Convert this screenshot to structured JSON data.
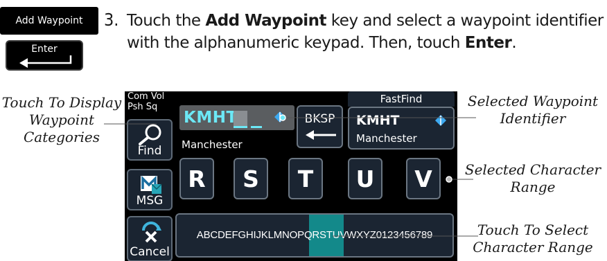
{
  "instruction": {
    "add_waypoint_key": "Add Waypoint",
    "enter_key": "Enter",
    "step_number": "3.",
    "text_1": "Touch the ",
    "bold_1": "Add Waypoint",
    "text_2": " key and select a waypoint identifier with the alphanumeric keypad. Then, touch ",
    "bold_2": "Enter",
    "text_3": "."
  },
  "screen": {
    "top_left_label_line1": "Com Vol",
    "top_left_label_line2": "Psh Sq",
    "waypoint_field_value": "KMHT",
    "waypoint_name": "Manchester",
    "bksp_label": "BKSP",
    "fastfind_header": "FastFind",
    "fastfind_identifier": "KMHT",
    "fastfind_name": "Manchester",
    "side_keys": {
      "find": "Find",
      "msg": "MSG",
      "cancel": "Cancel"
    },
    "letter_keys": [
      "R",
      "S",
      "T",
      "U",
      "V"
    ],
    "character_ranges": "ABCDEFGHIJKLMNOPQRSTUVWXYZ0123456789"
  },
  "callouts": {
    "left": "Touch To Display Waypoint Categories",
    "right_1": "Selected Waypoint Identifier",
    "right_2": "Selected Character Range",
    "right_3": "Touch To Select Character Range"
  },
  "colors": {
    "identifier_cyan": "#6ce8f6",
    "range_highlight": "#13898a",
    "key_fill": "#1b2532",
    "key_border": "#6b7682"
  }
}
